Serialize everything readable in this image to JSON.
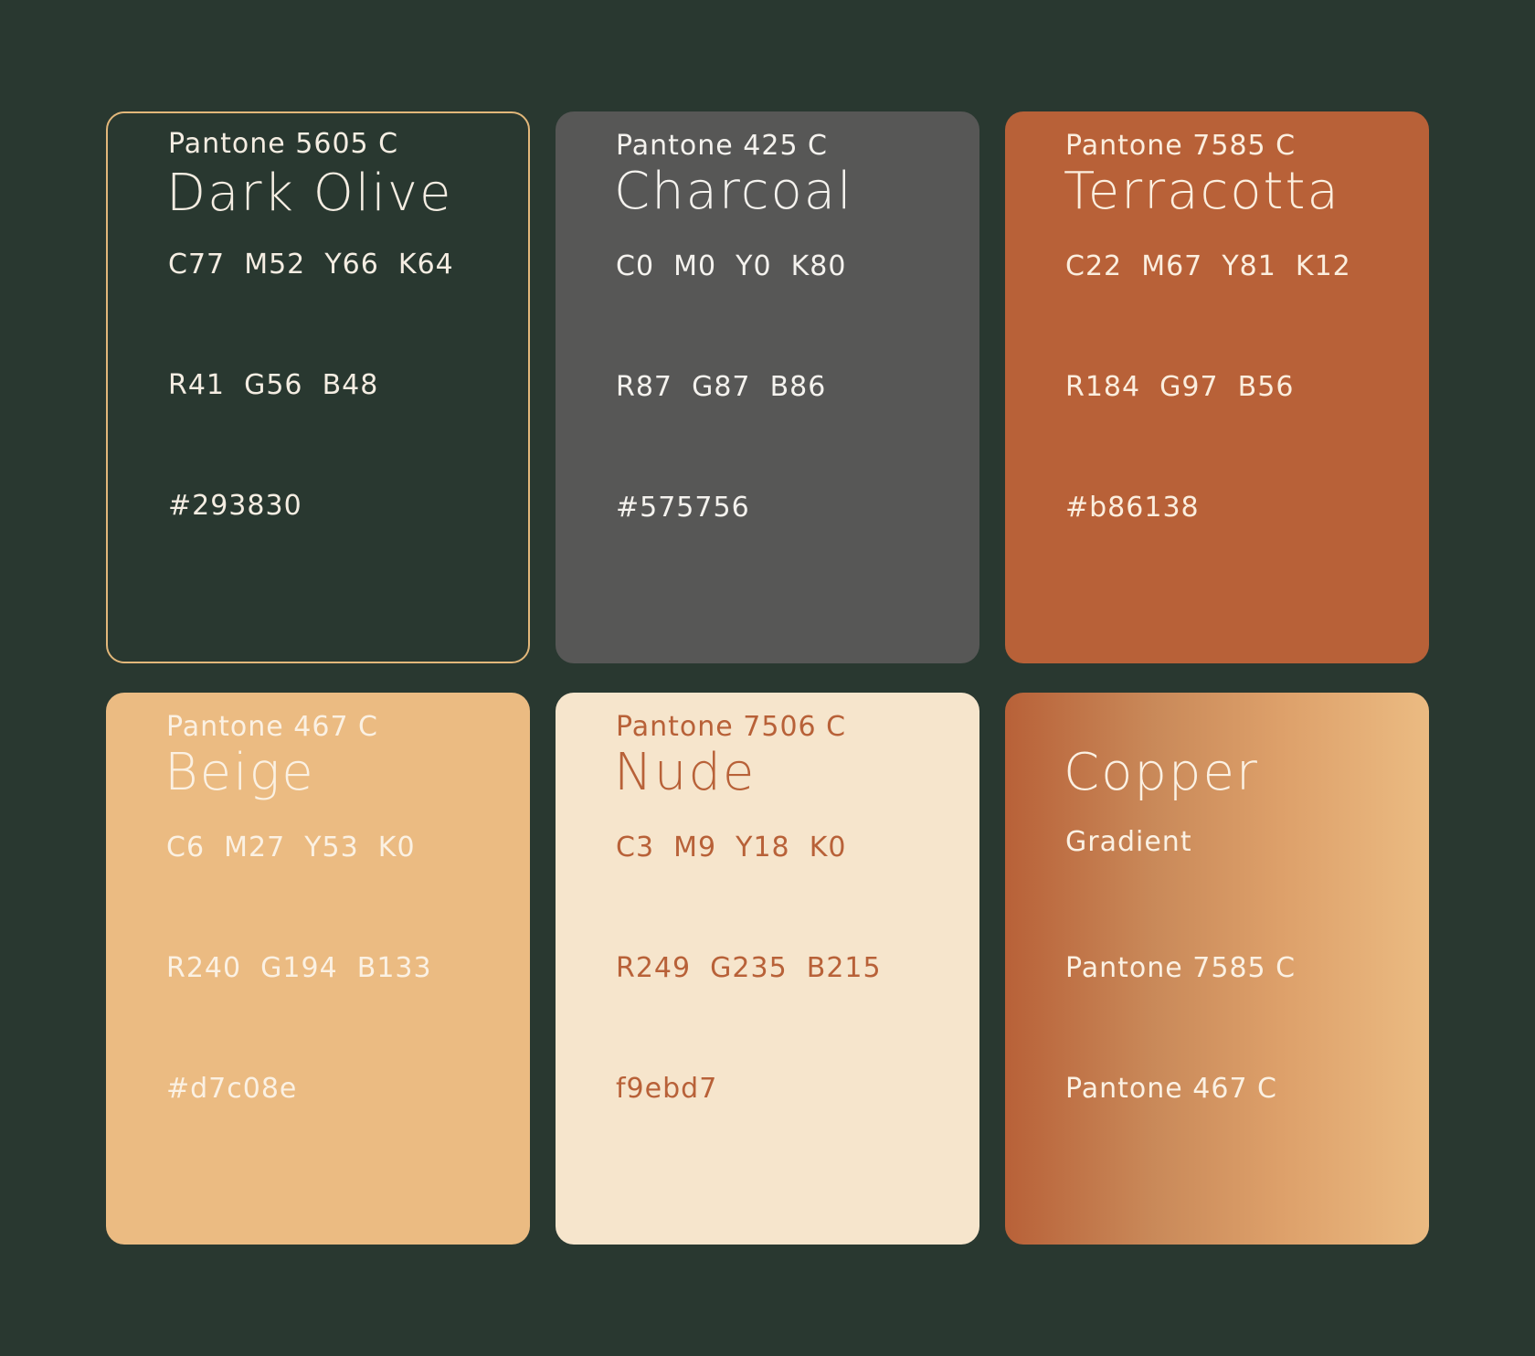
{
  "swatches": [
    {
      "name": "Dark Olive",
      "pantone": "Pantone 5605 C",
      "cmyk": "C77  M52  Y66  K64",
      "rgb": "R41  G56  B48",
      "hex": "#293830",
      "color": "#293830"
    },
    {
      "name": "Charcoal",
      "pantone": "Pantone 425 C",
      "cmyk": "C0  M0  Y0  K80",
      "rgb": "R87  G87  B86",
      "hex": "#575756",
      "color": "#575756"
    },
    {
      "name": "Terracotta",
      "pantone": "Pantone 7585 C",
      "cmyk": "C22  M67  Y81  K12",
      "rgb": "R184  G97  B56",
      "hex": "#b86138",
      "color": "#b86138"
    },
    {
      "name": "Beige",
      "pantone": "Pantone 467 C",
      "cmyk": "C6  M27  Y53  K0",
      "rgb": "R240  G194  B133",
      "hex": "#d7c08e",
      "color": "#ebbb82"
    },
    {
      "name": "Nude",
      "pantone": "Pantone 7506 C",
      "cmyk": "C3  M9  Y18  K0",
      "rgb": "R249  G235  B215",
      "hex": "f9ebd7",
      "color": "#f6e5cc"
    },
    {
      "name": "Copper",
      "subtitle": "Gradient",
      "pantone_1": "Pantone 7585 C",
      "pantone_2": "Pantone 467 C",
      "gradient_from": "#b86138",
      "gradient_to": "#ebbb82"
    }
  ]
}
